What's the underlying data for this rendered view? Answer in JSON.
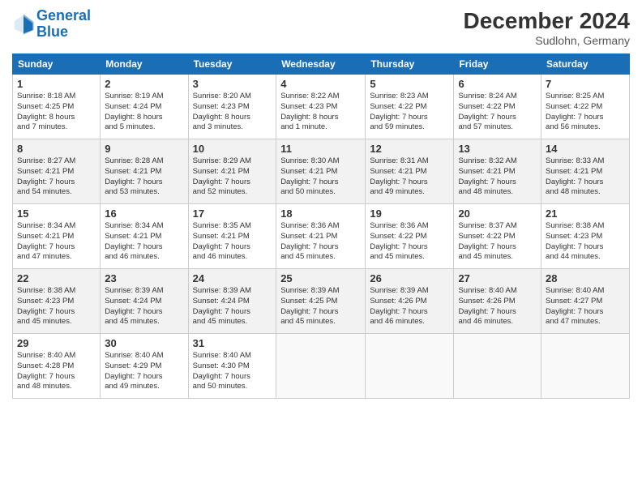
{
  "header": {
    "logo_line1": "General",
    "logo_line2": "Blue",
    "month": "December 2024",
    "location": "Sudlohn, Germany"
  },
  "weekdays": [
    "Sunday",
    "Monday",
    "Tuesday",
    "Wednesday",
    "Thursday",
    "Friday",
    "Saturday"
  ],
  "weeks": [
    [
      {
        "day": "1",
        "info": "Sunrise: 8:18 AM\nSunset: 4:25 PM\nDaylight: 8 hours\nand 7 minutes."
      },
      {
        "day": "2",
        "info": "Sunrise: 8:19 AM\nSunset: 4:24 PM\nDaylight: 8 hours\nand 5 minutes."
      },
      {
        "day": "3",
        "info": "Sunrise: 8:20 AM\nSunset: 4:23 PM\nDaylight: 8 hours\nand 3 minutes."
      },
      {
        "day": "4",
        "info": "Sunrise: 8:22 AM\nSunset: 4:23 PM\nDaylight: 8 hours\nand 1 minute."
      },
      {
        "day": "5",
        "info": "Sunrise: 8:23 AM\nSunset: 4:22 PM\nDaylight: 7 hours\nand 59 minutes."
      },
      {
        "day": "6",
        "info": "Sunrise: 8:24 AM\nSunset: 4:22 PM\nDaylight: 7 hours\nand 57 minutes."
      },
      {
        "day": "7",
        "info": "Sunrise: 8:25 AM\nSunset: 4:22 PM\nDaylight: 7 hours\nand 56 minutes."
      }
    ],
    [
      {
        "day": "8",
        "info": "Sunrise: 8:27 AM\nSunset: 4:21 PM\nDaylight: 7 hours\nand 54 minutes."
      },
      {
        "day": "9",
        "info": "Sunrise: 8:28 AM\nSunset: 4:21 PM\nDaylight: 7 hours\nand 53 minutes."
      },
      {
        "day": "10",
        "info": "Sunrise: 8:29 AM\nSunset: 4:21 PM\nDaylight: 7 hours\nand 52 minutes."
      },
      {
        "day": "11",
        "info": "Sunrise: 8:30 AM\nSunset: 4:21 PM\nDaylight: 7 hours\nand 50 minutes."
      },
      {
        "day": "12",
        "info": "Sunrise: 8:31 AM\nSunset: 4:21 PM\nDaylight: 7 hours\nand 49 minutes."
      },
      {
        "day": "13",
        "info": "Sunrise: 8:32 AM\nSunset: 4:21 PM\nDaylight: 7 hours\nand 48 minutes."
      },
      {
        "day": "14",
        "info": "Sunrise: 8:33 AM\nSunset: 4:21 PM\nDaylight: 7 hours\nand 48 minutes."
      }
    ],
    [
      {
        "day": "15",
        "info": "Sunrise: 8:34 AM\nSunset: 4:21 PM\nDaylight: 7 hours\nand 47 minutes."
      },
      {
        "day": "16",
        "info": "Sunrise: 8:34 AM\nSunset: 4:21 PM\nDaylight: 7 hours\nand 46 minutes."
      },
      {
        "day": "17",
        "info": "Sunrise: 8:35 AM\nSunset: 4:21 PM\nDaylight: 7 hours\nand 46 minutes."
      },
      {
        "day": "18",
        "info": "Sunrise: 8:36 AM\nSunset: 4:21 PM\nDaylight: 7 hours\nand 45 minutes."
      },
      {
        "day": "19",
        "info": "Sunrise: 8:36 AM\nSunset: 4:22 PM\nDaylight: 7 hours\nand 45 minutes."
      },
      {
        "day": "20",
        "info": "Sunrise: 8:37 AM\nSunset: 4:22 PM\nDaylight: 7 hours\nand 45 minutes."
      },
      {
        "day": "21",
        "info": "Sunrise: 8:38 AM\nSunset: 4:23 PM\nDaylight: 7 hours\nand 44 minutes."
      }
    ],
    [
      {
        "day": "22",
        "info": "Sunrise: 8:38 AM\nSunset: 4:23 PM\nDaylight: 7 hours\nand 45 minutes."
      },
      {
        "day": "23",
        "info": "Sunrise: 8:39 AM\nSunset: 4:24 PM\nDaylight: 7 hours\nand 45 minutes."
      },
      {
        "day": "24",
        "info": "Sunrise: 8:39 AM\nSunset: 4:24 PM\nDaylight: 7 hours\nand 45 minutes."
      },
      {
        "day": "25",
        "info": "Sunrise: 8:39 AM\nSunset: 4:25 PM\nDaylight: 7 hours\nand 45 minutes."
      },
      {
        "day": "26",
        "info": "Sunrise: 8:39 AM\nSunset: 4:26 PM\nDaylight: 7 hours\nand 46 minutes."
      },
      {
        "day": "27",
        "info": "Sunrise: 8:40 AM\nSunset: 4:26 PM\nDaylight: 7 hours\nand 46 minutes."
      },
      {
        "day": "28",
        "info": "Sunrise: 8:40 AM\nSunset: 4:27 PM\nDaylight: 7 hours\nand 47 minutes."
      }
    ],
    [
      {
        "day": "29",
        "info": "Sunrise: 8:40 AM\nSunset: 4:28 PM\nDaylight: 7 hours\nand 48 minutes."
      },
      {
        "day": "30",
        "info": "Sunrise: 8:40 AM\nSunset: 4:29 PM\nDaylight: 7 hours\nand 49 minutes."
      },
      {
        "day": "31",
        "info": "Sunrise: 8:40 AM\nSunset: 4:30 PM\nDaylight: 7 hours\nand 50 minutes."
      },
      null,
      null,
      null,
      null
    ]
  ]
}
